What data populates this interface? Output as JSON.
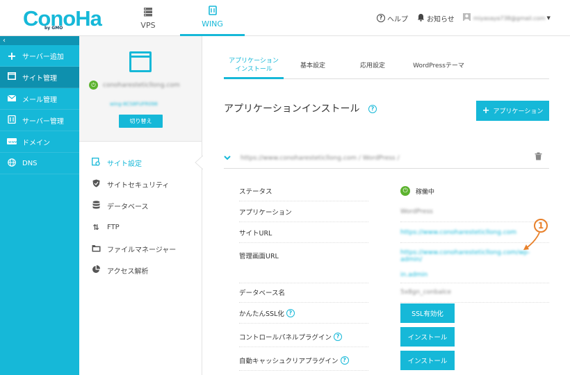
{
  "header": {
    "logo": "ConoHa",
    "logo_sub": "by GMO",
    "tabs": [
      {
        "label": "VPS",
        "icon": "server-icon"
      },
      {
        "label": "WING",
        "icon": "wing-server-icon"
      }
    ],
    "help": "ヘルプ",
    "notice": "お知らせ",
    "user": "miyasaya738@gmail.com"
  },
  "sidebar": {
    "collapse": "‹",
    "items": [
      {
        "label": "サーバー追加",
        "icon": "plus-icon"
      },
      {
        "label": "サイト管理",
        "icon": "window-icon"
      },
      {
        "label": "メール管理",
        "icon": "mail-icon"
      },
      {
        "label": "サーバー管理",
        "icon": "server-icon"
      },
      {
        "label": "ドメイン",
        "icon": "domain-icon"
      },
      {
        "label": "DNS",
        "icon": "globe-icon"
      }
    ]
  },
  "subpanel": {
    "site_name": "conoharesteticllong.com",
    "site_sub": "wing-8CS8FUFR098",
    "switch_label": "切り替え",
    "menu": [
      {
        "label": "サイト設定",
        "icon": "settings-icon"
      },
      {
        "label": "サイトセキュリティ",
        "icon": "shield-icon"
      },
      {
        "label": "データベース",
        "icon": "database-icon"
      },
      {
        "label": "FTP",
        "icon": "transfer-icon"
      },
      {
        "label": "ファイルマネージャー",
        "icon": "folder-icon"
      },
      {
        "label": "アクセス解析",
        "icon": "pie-chart-icon"
      }
    ]
  },
  "main": {
    "tabs": [
      {
        "label1": "アプリケーション",
        "label2": "インストール"
      },
      {
        "label1": "基本設定",
        "label2": ""
      },
      {
        "label1": "応用設定",
        "label2": ""
      },
      {
        "label1": "WordPressテーマ",
        "label2": ""
      }
    ],
    "title": "アプリケーションインストール",
    "add_button": "アプリケーション",
    "url_row": "https://www.conoharesteticllong.com / WordPress /",
    "rows": [
      {
        "label": "ステータス",
        "value": "稼働中"
      },
      {
        "label": "アプリケーション",
        "value": "WordPress"
      },
      {
        "label": "サイトURL",
        "value": "https://www.conoharesteticllong.com"
      },
      {
        "label": "管理画面URL",
        "value": "https://www.conoharesteticllong.com/wp-admin/",
        "value2": "in.admin"
      },
      {
        "label": "データベース名",
        "value": "5x8gn_conbalce"
      },
      {
        "label": "かんたんSSL化",
        "button": "SSL有効化"
      },
      {
        "label": "コントロールパネルプラグイン",
        "button": "インストール"
      },
      {
        "label": "自動キャッシュクリアプラグイン",
        "button": "インストール"
      }
    ]
  },
  "annotation": {
    "number": "1"
  }
}
